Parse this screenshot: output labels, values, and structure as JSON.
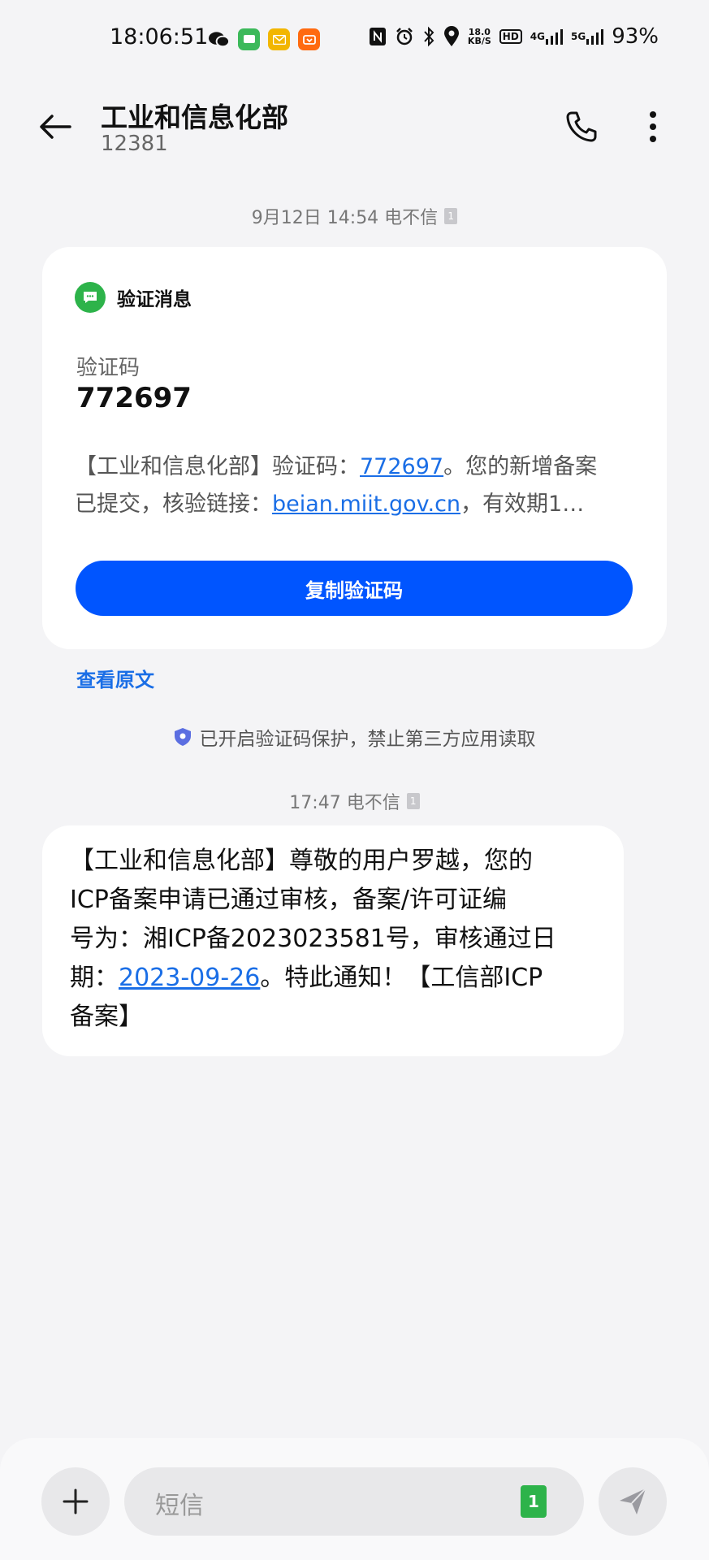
{
  "status_bar": {
    "time": "18:06:51",
    "speed_top": "18.0",
    "speed_bottom": "KB/S",
    "hd_label": "HD",
    "net1": "4G",
    "net2": "5G",
    "battery": "93%"
  },
  "header": {
    "title": "工业和信息化部",
    "number": "12381"
  },
  "messages": [
    {
      "timestamp": "9月12日 14:54 电不信",
      "sim": "1",
      "card": {
        "header": "验证消息",
        "code_label": "验证码",
        "code_value": "772697",
        "body_prefix": "【工业和信息化部】验证码：",
        "body_code_link": "772697",
        "body_mid": "。您的新增备案",
        "body_line2_prefix": "已提交，核验链接：",
        "body_url_link": "beian.miit.gov.cn",
        "body_line2_suffix": "，有效期1…",
        "copy_button": "复制验证码"
      },
      "view_original": "查看原文"
    },
    {
      "timestamp": "17:47 电不信",
      "sim": "1",
      "lines": [
        "【工业和信息化部】尊敬的用户罗越，您的",
        "ICP备案申请已通过审核，备案/许可证编",
        "号为：湘ICP备2023023581号，审核通过日"
      ],
      "line4_prefix": "期：",
      "date_link": "2023-09-26",
      "line4_suffix": "。特此通知！【工信部ICP",
      "line5": "备案】"
    }
  ],
  "protection_notice": "已开启验证码保护，禁止第三方应用读取",
  "composer": {
    "placeholder": "短信",
    "sim": "1"
  },
  "colors": {
    "accent_blue": "#0055ff",
    "link_blue": "#1a6ee6",
    "green": "#2db34a",
    "background": "#f4f4f6"
  }
}
